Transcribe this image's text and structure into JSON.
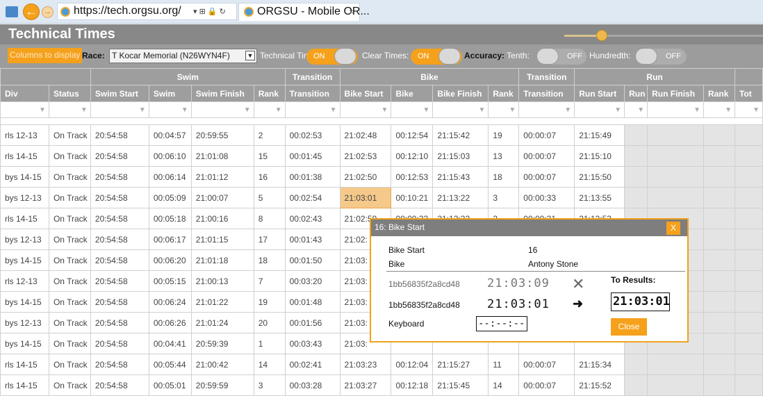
{
  "browser": {
    "url": "https://tech.orgsu.org/",
    "url_tools": "▾ ⊞ 🔒 ↻",
    "tab_title": "ORGSU - Mobile OR...",
    "tab_close": "×",
    "back_glyph": "←",
    "fwd_glyph": "→"
  },
  "app": {
    "title": "Technical Times"
  },
  "toolbar": {
    "columns_button": "Columns to display",
    "race_label": "Race:",
    "race_value": "T Kocar Memorial (N26WYN4F)",
    "technical_times_label": "Technical Times:",
    "technical_times_state": "ON",
    "clear_times_label": "Clear Times:",
    "clear_times_state": "ON",
    "accuracy_label": "Accuracy:",
    "tenth_label": "Tenth:",
    "tenth_state": "OFF",
    "hundredth_label": "Hundredth:",
    "hundredth_state": "OFF"
  },
  "table": {
    "groups": [
      "",
      "Swim",
      "Transition",
      "Bike",
      "Transition",
      "Run",
      ""
    ],
    "headers": [
      "Div",
      "Status",
      "Swim Start",
      "Swim",
      "Swim Finish",
      "Rank",
      "Transition",
      "Bike Start",
      "Bike",
      "Bike Finish",
      "Rank",
      "Transition",
      "Run Start",
      "Run",
      "Run Finish",
      "Rank",
      "Tot"
    ],
    "rows": [
      {
        "div": "rls 12-13",
        "status": "On Track",
        "swim_start": "20:54:58",
        "swim": "00:04:57",
        "swim_finish": "20:59:55",
        "swim_rank": "2",
        "t1": "00:02:53",
        "bike_start": "21:02:48",
        "bike": "00:12:54",
        "bike_finish": "21:15:42",
        "bike_rank": "19",
        "t2": "00:00:07",
        "run_start": "21:15:49"
      },
      {
        "div": "rls 14-15",
        "status": "On Track",
        "swim_start": "20:54:58",
        "swim": "00:06:10",
        "swim_finish": "21:01:08",
        "swim_rank": "15",
        "t1": "00:01:45",
        "bike_start": "21:02:53",
        "bike": "00:12:10",
        "bike_finish": "21:15:03",
        "bike_rank": "13",
        "t2": "00:00:07",
        "run_start": "21:15:10"
      },
      {
        "div": "bys 14-15",
        "status": "On Track",
        "swim_start": "20:54:58",
        "swim": "00:06:14",
        "swim_finish": "21:01:12",
        "swim_rank": "16",
        "t1": "00:01:38",
        "bike_start": "21:02:50",
        "bike": "00:12:53",
        "bike_finish": "21:15:43",
        "bike_rank": "18",
        "t2": "00:00:07",
        "run_start": "21:15:50"
      },
      {
        "div": "bys 12-13",
        "status": "On Track",
        "swim_start": "20:54:58",
        "swim": "00:05:09",
        "swim_finish": "21:00:07",
        "swim_rank": "5",
        "t1": "00:02:54",
        "bike_start": "21:03:01",
        "bike": "00:10:21",
        "bike_finish": "21:13:22",
        "bike_rank": "3",
        "t2": "00:00:33",
        "run_start": "21:13:55"
      },
      {
        "div": "rls 14-15",
        "status": "On Track",
        "swim_start": "20:54:58",
        "swim": "00:05:18",
        "swim_finish": "21:00:16",
        "swim_rank": "8",
        "t1": "00:02:43",
        "bike_start": "21:02:59",
        "bike": "00:09:33",
        "bike_finish": "21:12:32",
        "bike_rank": "2",
        "t2": "00:00:21",
        "run_start": "21:12:53"
      },
      {
        "div": "bys 12-13",
        "status": "On Track",
        "swim_start": "20:54:58",
        "swim": "00:06:17",
        "swim_finish": "21:01:15",
        "swim_rank": "17",
        "t1": "00:01:43",
        "bike_start": "21:02:",
        "bike": "",
        "bike_finish": "",
        "bike_rank": "",
        "t2": "",
        "run_start": ""
      },
      {
        "div": "bys 14-15",
        "status": "On Track",
        "swim_start": "20:54:58",
        "swim": "00:06:20",
        "swim_finish": "21:01:18",
        "swim_rank": "18",
        "t1": "00:01:50",
        "bike_start": "21:03:",
        "bike": "",
        "bike_finish": "",
        "bike_rank": "",
        "t2": "",
        "run_start": ""
      },
      {
        "div": "rls 12-13",
        "status": "On Track",
        "swim_start": "20:54:58",
        "swim": "00:05:15",
        "swim_finish": "21:00:13",
        "swim_rank": "7",
        "t1": "00:03:20",
        "bike_start": "21:03:",
        "bike": "",
        "bike_finish": "",
        "bike_rank": "",
        "t2": "",
        "run_start": ""
      },
      {
        "div": "bys 14-15",
        "status": "On Track",
        "swim_start": "20:54:58",
        "swim": "00:06:24",
        "swim_finish": "21:01:22",
        "swim_rank": "19",
        "t1": "00:01:48",
        "bike_start": "21:03:",
        "bike": "",
        "bike_finish": "",
        "bike_rank": "",
        "t2": "",
        "run_start": ""
      },
      {
        "div": "bys 12-13",
        "status": "On Track",
        "swim_start": "20:54:58",
        "swim": "00:06:26",
        "swim_finish": "21:01:24",
        "swim_rank": "20",
        "t1": "00:01:56",
        "bike_start": "21:03:",
        "bike": "",
        "bike_finish": "",
        "bike_rank": "",
        "t2": "",
        "run_start": ""
      },
      {
        "div": "bys 14-15",
        "status": "On Track",
        "swim_start": "20:54:58",
        "swim": "00:04:41",
        "swim_finish": "20:59:39",
        "swim_rank": "1",
        "t1": "00:03:43",
        "bike_start": "21:03:",
        "bike": "",
        "bike_finish": "",
        "bike_rank": "",
        "t2": "",
        "run_start": ""
      },
      {
        "div": "rls 14-15",
        "status": "On Track",
        "swim_start": "20:54:58",
        "swim": "00:05:44",
        "swim_finish": "21:00:42",
        "swim_rank": "14",
        "t1": "00:02:41",
        "bike_start": "21:03:23",
        "bike": "00:12:04",
        "bike_finish": "21:15:27",
        "bike_rank": "11",
        "t2": "00:00:07",
        "run_start": "21:15:34"
      },
      {
        "div": "rls 14-15",
        "status": "On Track",
        "swim_start": "20:54:58",
        "swim": "00:05:01",
        "swim_finish": "20:59:59",
        "swim_rank": "3",
        "t1": "00:03:28",
        "bike_start": "21:03:27",
        "bike": "00:12:18",
        "bike_finish": "21:15:45",
        "bike_rank": "14",
        "t2": "00:00:07",
        "run_start": "21:15:52"
      }
    ]
  },
  "dialog": {
    "title": "16: Bike Start",
    "close_x": "X",
    "field_name": "Bike Start",
    "field_value": "16",
    "category": "Bike",
    "athlete": "Antony Stone",
    "to_results_label": "To Results:",
    "source1_id": "1bb56835f2a8cd48",
    "source1_time": "21:03:09",
    "source1_action": "✕",
    "source2_id": "1bb56835f2a8cd48",
    "source2_time": "21:03:01",
    "source2_action": "➜",
    "keyboard_label": "Keyboard",
    "keyboard_value": "--:--:--",
    "result_value": "21:03:01",
    "close_button": "Close"
  },
  "colors": {
    "accent": "#f5a11c",
    "header_grey": "#9e9e9e",
    "highlight": "#f5c98a"
  }
}
